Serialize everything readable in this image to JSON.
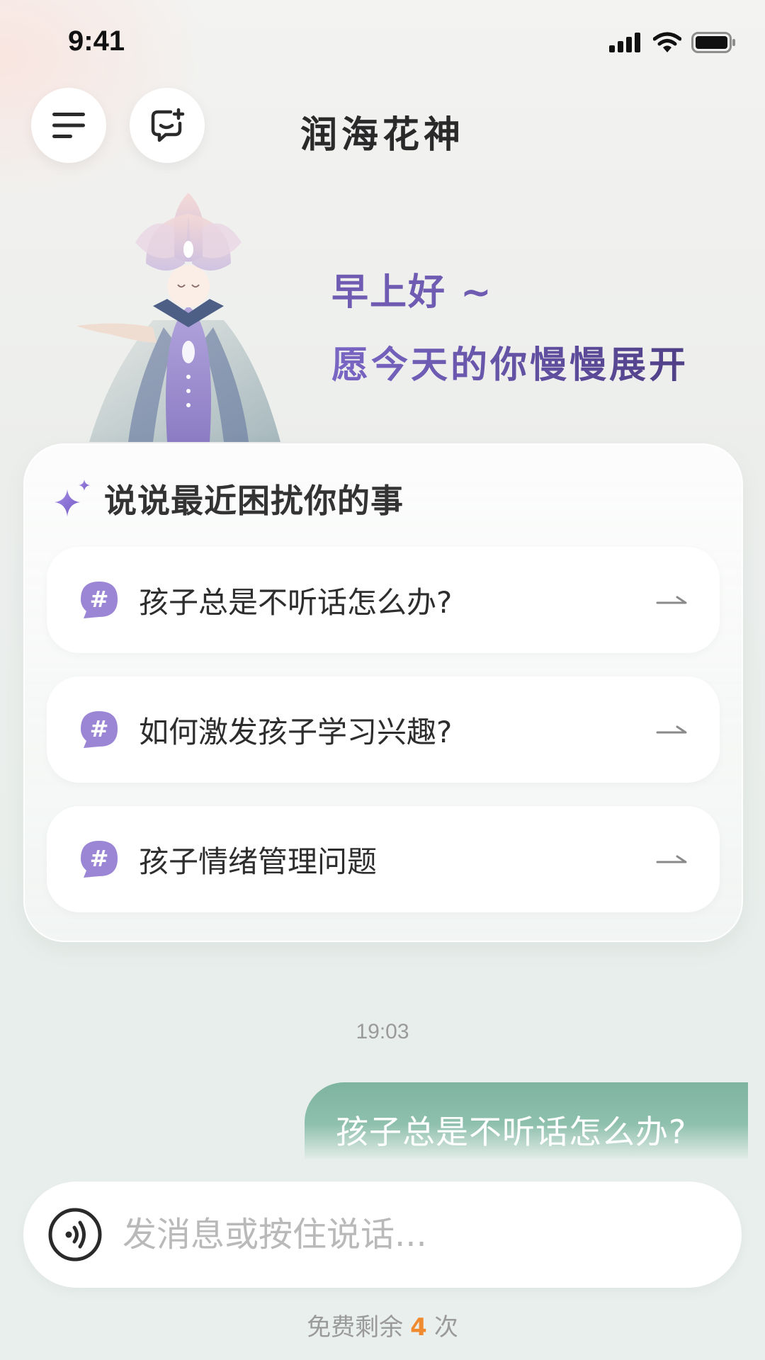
{
  "status_bar": {
    "time": "9:41",
    "icons": [
      "signal-icon",
      "wifi-icon",
      "battery-icon"
    ]
  },
  "header": {
    "menu_icon": "menu-icon",
    "new_chat_icon": "new-chat-icon",
    "title": "润海花神"
  },
  "hero": {
    "greeting_line1": "早上好 ~",
    "greeting_line2": "愿今天的你慢慢展开"
  },
  "topics": {
    "heading": "说说最近困扰你的事",
    "heading_icon": "sparkle-icon",
    "items": [
      {
        "label": "孩子总是不听话怎么办?",
        "icon": "hash-chat-icon"
      },
      {
        "label": "如何激发孩子学习兴趣?",
        "icon": "hash-chat-icon"
      },
      {
        "label": "孩子情绪管理问题",
        "icon": "hash-chat-icon"
      }
    ]
  },
  "chat": {
    "timestamp": "19:03",
    "messages": [
      {
        "role": "user",
        "text": "孩子总是不听话怎么办?"
      }
    ]
  },
  "input": {
    "placeholder": "发消息或按住说话...",
    "voice_icon": "voice-icon"
  },
  "quota": {
    "prefix": "免费剩余",
    "count": "4",
    "suffix": "次"
  },
  "colors": {
    "accent_purple": "#6f5bb2",
    "bubble_green": "#7db4a0",
    "quota_orange": "#f08a2e",
    "hash_badge": "#9b86d6"
  }
}
